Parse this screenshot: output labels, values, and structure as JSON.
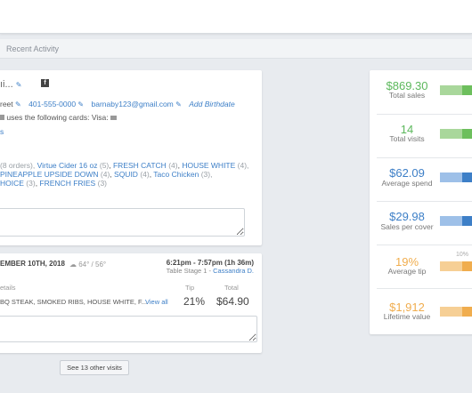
{
  "tabs": {
    "recent_activity": "Recent Activity"
  },
  "profile": {
    "name_fragment": "ıi...",
    "social_icon": "facebook-icon",
    "street_fragment": "reet",
    "phone": "401-555-0000",
    "email": "barnaby123@gmail.com",
    "add_birthdate": "Add Birthdate",
    "cards_text": "uses the following cards:",
    "visa_label": "Visa:",
    "link_fragment": "s",
    "orders_count_fragment": "(8 orders),",
    "items_line1": [
      {
        "name": "Virtue Cider 16 oz",
        "count": "(5)"
      },
      {
        "name": "FRESH CATCH",
        "count": "(4)"
      },
      {
        "name": "HOUSE WHITE",
        "count": "(4),"
      }
    ],
    "items_line2": [
      {
        "name": "PINEAPPLE UPSIDE DOWN",
        "count": "(4)"
      },
      {
        "name": "SQUID",
        "count": "(4)"
      },
      {
        "name": "Taco Chicken",
        "count": "(3),"
      }
    ],
    "items_line3": [
      {
        "name": "HOICE",
        "count": "(3)"
      },
      {
        "name": "FRENCH FRIES",
        "count": "(3)"
      }
    ]
  },
  "visit": {
    "date": "EMBER 10TH, 2018",
    "weather": "64° / 56°",
    "time": "6:21pm - 7:57pm (1h 36m)",
    "table_prefix": "Table Stage 1 -",
    "server": "Cassandra D.",
    "col_details": "etails",
    "col_tip": "Tip",
    "col_total": "Total",
    "items": "BQ STEAK, SMOKED RIBS, HOUSE WHITE, F...",
    "view_all": "View all",
    "tip": "21%",
    "total": "$64.90",
    "see_other": "See 13 other visits"
  },
  "stats": [
    {
      "value": "$869.30",
      "label": "Total sales",
      "color": "#5cb85c"
    },
    {
      "value": "14",
      "label": "Total visits",
      "color": "#5cb85c"
    },
    {
      "value": "$62.09",
      "label": "Average spend",
      "color": "#3d7fc7"
    },
    {
      "value": "$29.98",
      "label": "Sales per cover",
      "color": "#3d7fc7"
    },
    {
      "value": "19%",
      "label": "Average tip",
      "color": "#f0ad4e",
      "marker": "10%"
    },
    {
      "value": "$1,912",
      "label": "Lifetime value",
      "color": "#f0ad4e"
    }
  ]
}
